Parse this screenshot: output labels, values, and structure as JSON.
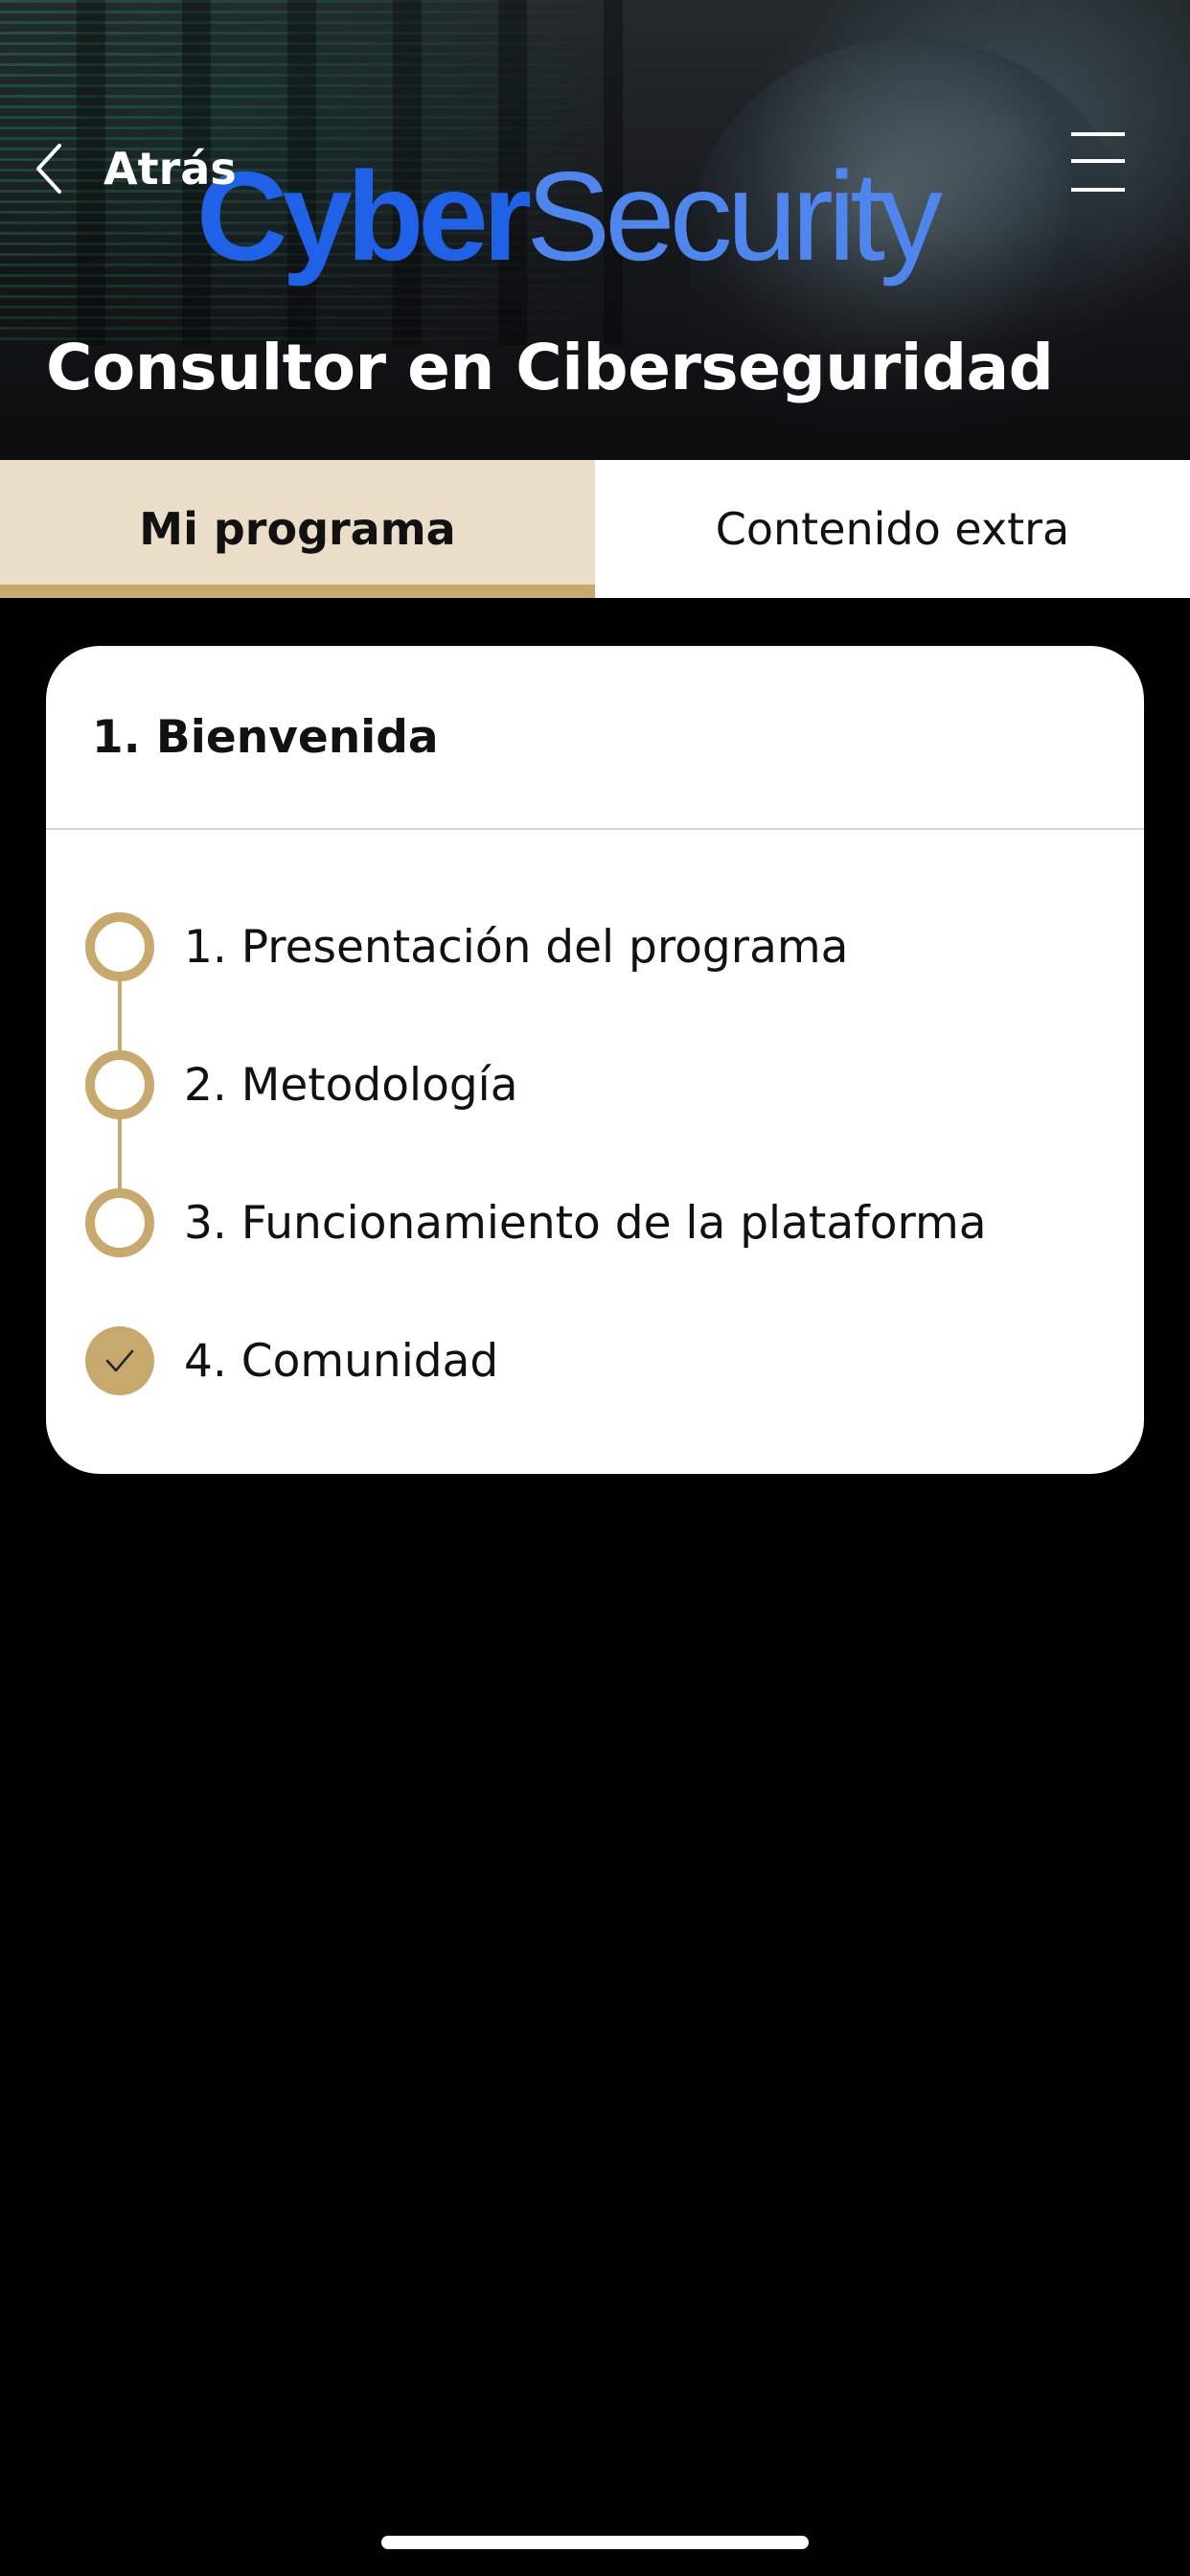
{
  "header": {
    "back_label": "Atrás",
    "brand_logo": {
      "part1": "Cyber",
      "part2": "Security"
    },
    "title": "Consultor en Ciberseguridad"
  },
  "tabs": [
    {
      "label": "Mi programa",
      "active": true
    },
    {
      "label": "Contenido extra",
      "active": false
    }
  ],
  "module": {
    "title": "1. Bienvenida",
    "lessons": [
      {
        "label": "1. Presentación del programa",
        "completed": false
      },
      {
        "label": "2. Metodología",
        "completed": false
      },
      {
        "label": "3. Funcionamiento de la plataforma",
        "completed": false
      },
      {
        "label": "4. Comunidad",
        "completed": true
      }
    ]
  },
  "icons": {
    "back": "chevron-left-icon",
    "menu": "hamburger-menu-icon",
    "lesson_pending": "empty-circle-icon",
    "lesson_done": "check-circle-icon"
  },
  "colors": {
    "accent_gold": "#c8a96d",
    "active_tab_bg": "#ebdec8",
    "page_bg": "#000000",
    "card_bg": "#ffffff",
    "brand_blue": "#1f62e8"
  }
}
